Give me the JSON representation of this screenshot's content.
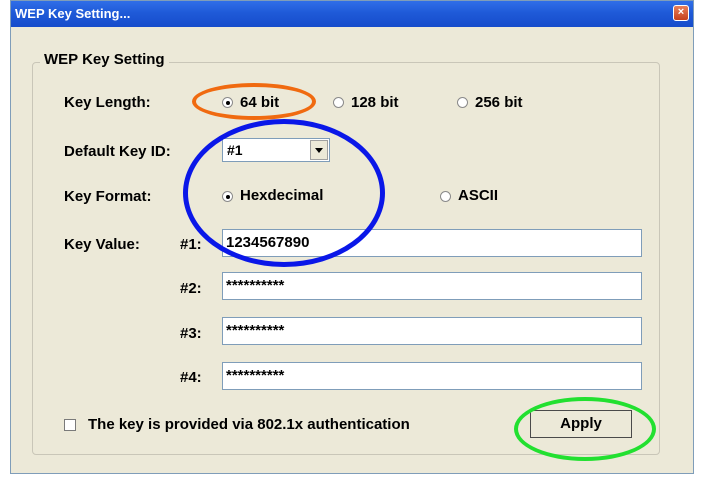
{
  "window": {
    "title": "WEP Key Setting...",
    "close_glyph": "×"
  },
  "group": {
    "label": "WEP Key Setting"
  },
  "key_length": {
    "label": "Key Length:",
    "options": [
      {
        "label": "64 bit",
        "selected": true
      },
      {
        "label": "128 bit",
        "selected": false
      },
      {
        "label": "256 bit",
        "selected": false
      }
    ]
  },
  "default_key": {
    "label": "Default Key ID:",
    "value": "#1"
  },
  "key_format": {
    "label": "Key Format:",
    "options": [
      {
        "label": "Hexdecimal",
        "selected": true
      },
      {
        "label": "ASCII",
        "selected": false
      }
    ]
  },
  "key_value": {
    "label": "Key Value:",
    "keys": [
      {
        "id": "#1:",
        "value": "1234567890"
      },
      {
        "id": "#2:",
        "value": "**********"
      },
      {
        "id": "#3:",
        "value": "**********"
      },
      {
        "id": "#4:",
        "value": "**********"
      }
    ]
  },
  "auth": {
    "label": "The key is provided via 802.1x authentication",
    "checked": false
  },
  "apply": {
    "label": "Apply"
  },
  "highlights": {
    "orange": "#f06a10",
    "blue": "#0a17e8",
    "green": "#22e030"
  }
}
